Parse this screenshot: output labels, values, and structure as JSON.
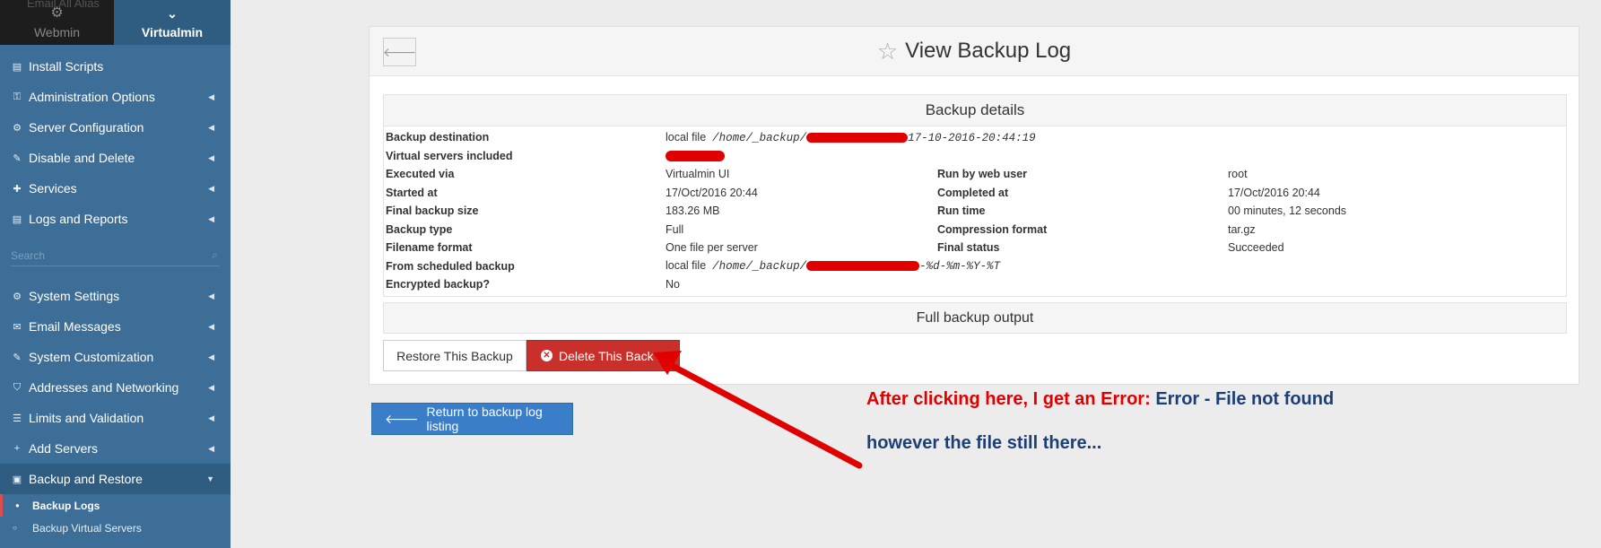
{
  "sidebar": {
    "ghost_text": "Email All Alias",
    "tabs": {
      "webmin": "Webmin",
      "virtualmin": "Virtualmin"
    },
    "items_top": [
      {
        "label": "Install Scripts",
        "icon": "scripts-icon",
        "glyph": "▤",
        "caret": false
      },
      {
        "label": "Administration Options",
        "icon": "key-icon",
        "glyph": "⚿",
        "caret": true
      },
      {
        "label": "Server Configuration",
        "icon": "cogs-icon",
        "glyph": "⚙",
        "caret": true
      },
      {
        "label": "Disable and Delete",
        "icon": "wrench-icon",
        "glyph": "✎",
        "caret": true
      },
      {
        "label": "Services",
        "icon": "puzzle-icon",
        "glyph": "✚",
        "caret": true
      },
      {
        "label": "Logs and Reports",
        "icon": "file-icon",
        "glyph": "▤",
        "caret": true
      }
    ],
    "search_placeholder": "Search",
    "items_bottom": [
      {
        "label": "System Settings",
        "icon": "gear-icon",
        "glyph": "⚙",
        "caret": true
      },
      {
        "label": "Email Messages",
        "icon": "envelope-icon",
        "glyph": "✉",
        "caret": true
      },
      {
        "label": "System Customization",
        "icon": "wrench-icon",
        "glyph": "✎",
        "caret": true
      },
      {
        "label": "Addresses and Networking",
        "icon": "shield-icon",
        "glyph": "⛉",
        "caret": true
      },
      {
        "label": "Limits and Validation",
        "icon": "list-icon",
        "glyph": "☰",
        "caret": true
      },
      {
        "label": "Add Servers",
        "icon": "plus-icon",
        "glyph": "+",
        "caret": true
      },
      {
        "label": "Backup and Restore",
        "icon": "save-icon",
        "glyph": "▣",
        "caret": true,
        "active": true
      }
    ],
    "sub_items": [
      {
        "label": "Backup Logs",
        "active": true
      },
      {
        "label": "Backup Virtual Servers",
        "active": false
      }
    ]
  },
  "page": {
    "title": "View Backup Log",
    "details_heading": "Backup details",
    "rows": {
      "destination": {
        "label": "Backup destination",
        "prefix": "local file",
        "path_start": "/home/_backup/",
        "path_end": "17-10-2016-20:44:19"
      },
      "vservers": {
        "label": "Virtual servers included"
      },
      "executed": {
        "label": "Executed via",
        "value": "Virtualmin UI",
        "label2": "Run by web user",
        "value2": "root"
      },
      "started": {
        "label": "Started at",
        "value": "17/Oct/2016 20:44",
        "label2": "Completed at",
        "value2": "17/Oct/2016 20:44"
      },
      "size": {
        "label": "Final backup size",
        "value": "183.26 MB",
        "label2": "Run time",
        "value2": "00 minutes, 12 seconds"
      },
      "type": {
        "label": "Backup type",
        "value": "Full",
        "label2": "Compression format",
        "value2": "tar.gz"
      },
      "filename": {
        "label": "Filename format",
        "value": "One file per server",
        "label2": "Final status",
        "value2": "Succeeded"
      },
      "scheduled": {
        "label": "From scheduled backup",
        "prefix": "local file",
        "path_start": "/home/_backup/",
        "path_end": "-%d-%m-%Y-%T"
      },
      "encrypted": {
        "label": "Encrypted backup?",
        "value": "No"
      }
    },
    "output_heading": "Full backup output",
    "buttons": {
      "restore": "Restore This Backup",
      "delete": "Delete This Back",
      "return": "Return to backup log listing"
    }
  },
  "annotation": {
    "line1_red": "After clicking here, I get an Error:",
    "line1_blue": "Error - File not found",
    "line2": "however the file still there...",
    "color_red": "#e00000",
    "color_blue": "#1b3f77"
  }
}
